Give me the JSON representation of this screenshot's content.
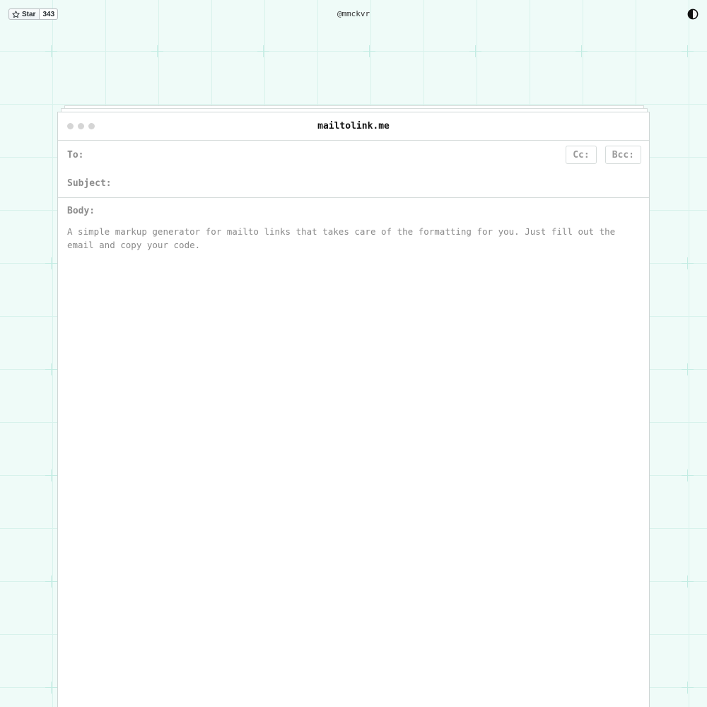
{
  "topbar": {
    "github_star_label": "Star",
    "github_star_count": "343",
    "author_handle": "@mmckvr",
    "theme_toggle_icon": "contrast-icon"
  },
  "window": {
    "title": "mailtolink.me",
    "to_label": "To:",
    "to_value": "",
    "cc_label": "Cc:",
    "bcc_label": "Bcc:",
    "subject_label": "Subject:",
    "subject_value": "",
    "body_label": "Body:",
    "body_placeholder": "A simple markup generator for mailto links that takes care of the formatting for you. Just fill out the email and copy your code."
  },
  "colors": {
    "background": "#effbf8",
    "grid_line": "#d8f2ec",
    "window_border": "#cfd6d5",
    "muted_text": "#8c8c8c"
  }
}
